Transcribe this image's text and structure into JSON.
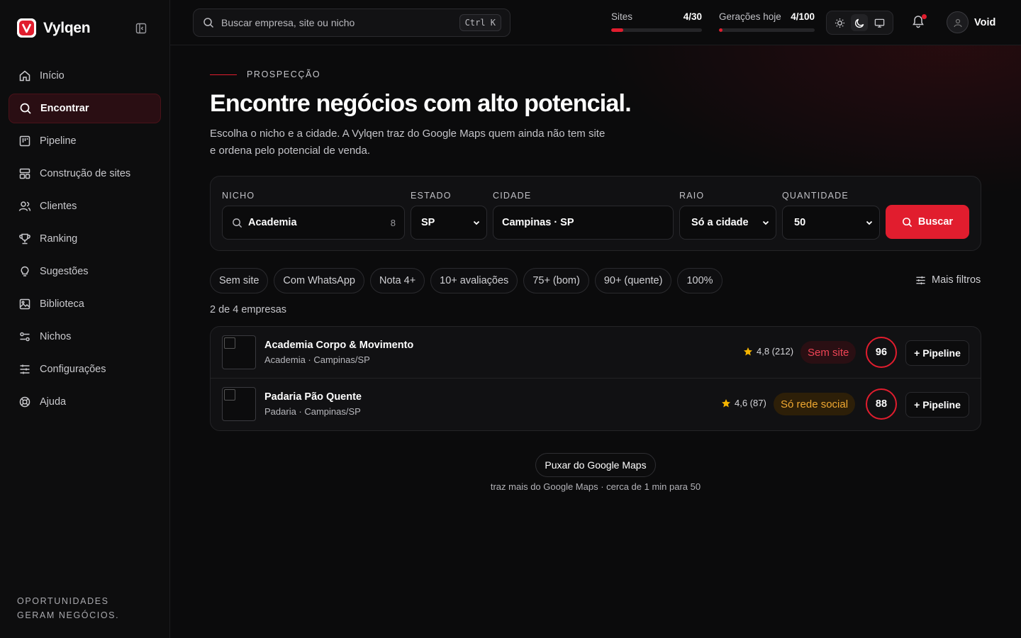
{
  "brand": {
    "name": "Vylqen",
    "accent": "#e11d2e"
  },
  "sidebar": {
    "items": [
      {
        "label": "Início",
        "icon": "home-icon",
        "active": false
      },
      {
        "label": "Encontrar",
        "icon": "search-icon",
        "active": true
      },
      {
        "label": "Pipeline",
        "icon": "kanban-icon",
        "active": false
      },
      {
        "label": "Construção de sites",
        "icon": "layout-icon",
        "active": false
      },
      {
        "label": "Clientes",
        "icon": "users-icon",
        "active": false
      },
      {
        "label": "Ranking",
        "icon": "trophy-icon",
        "active": false
      },
      {
        "label": "Sugestões",
        "icon": "lightbulb-icon",
        "active": false
      },
      {
        "label": "Biblioteca",
        "icon": "image-icon",
        "active": false
      },
      {
        "label": "Nichos",
        "icon": "sliders-icon",
        "active": false
      },
      {
        "label": "Configurações",
        "icon": "settings-sliders-icon",
        "active": false
      },
      {
        "label": "Ajuda",
        "icon": "help-icon",
        "active": false
      }
    ],
    "tagline_line1": "OPORTUNIDADES",
    "tagline_line2": "GERAM NEGÓCIOS."
  },
  "topbar": {
    "search_placeholder": "Buscar empresa, site ou nicho",
    "shortcut": "Ctrl K",
    "sites_label": "Sites",
    "sites_value": "4/30",
    "sites_fraction": 0.133,
    "geracoes_label": "Gerações hoje",
    "geracoes_value": "4/100",
    "geracoes_fraction": 0.04,
    "user_name": "Void"
  },
  "hero": {
    "eyebrow": "PROSPECÇÃO",
    "title": "Encontre negócios com alto potencial.",
    "subtitle_line1": "Escolha o nicho e a cidade. A Vylqen traz do Google Maps quem ainda não tem site",
    "subtitle_line2": "e ordena pelo potencial de venda."
  },
  "filters": {
    "nicho_label": "NICHO",
    "nicho_value": "Academia",
    "nicho_count": "8",
    "estado_label": "ESTADO",
    "estado_value": "SP",
    "cidade_label": "CIDADE",
    "cidade_value": "Campinas · SP",
    "raio_label": "RAIO",
    "raio_value": "Só a cidade",
    "quantidade_label": "QUANTIDADE",
    "quantidade_value": "50",
    "search_button": "Buscar"
  },
  "chips": [
    "Sem site",
    "Com WhatsApp",
    "Nota 4+",
    "10+ avaliações",
    "75+ (bom)",
    "90+ (quente)",
    "100%"
  ],
  "more_filters": "Mais filtros",
  "result_count": "2 de 4 empresas",
  "results": [
    {
      "name": "Academia Corpo & Movimento",
      "meta": "Academia · Campinas/SP",
      "rating": "4,8 (212)",
      "badge": "Sem site",
      "score": "96",
      "action": "+ Pipeline"
    },
    {
      "name": "Padaria Pão Quente",
      "meta": "Padaria · Campinas/SP",
      "rating": "4,6 (87)",
      "badge": "Só rede social",
      "score": "88",
      "action": "+ Pipeline"
    }
  ],
  "maps_button": "Puxar do Google Maps",
  "maps_hint": "traz mais do Google Maps · cerca de 1 min para 50"
}
